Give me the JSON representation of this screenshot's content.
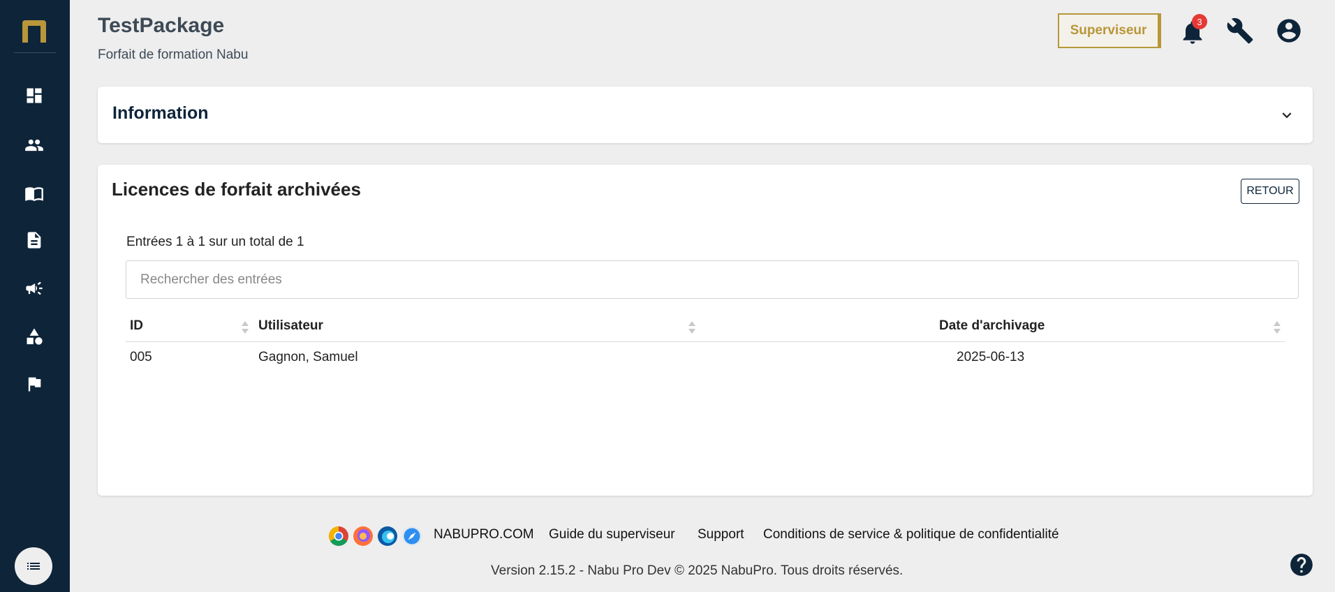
{
  "header": {
    "title": "TestPackage",
    "subtitle": "Forfait de formation Nabu",
    "role_button": "Superviseur",
    "notification_count": "3"
  },
  "sidebar": {
    "items": [
      {
        "icon": "dashboard-icon"
      },
      {
        "icon": "users-icon"
      },
      {
        "icon": "book-icon"
      },
      {
        "icon": "document-icon"
      },
      {
        "icon": "megaphone-icon"
      },
      {
        "icon": "shapes-icon"
      },
      {
        "icon": "flag-icon"
      }
    ],
    "toggle_icon": "list-icon"
  },
  "information": {
    "title": "Information"
  },
  "licences": {
    "title": "Licences de forfait archivées",
    "back_button": "RETOUR",
    "entries_text": "Entrées 1 à 1 sur un total de 1",
    "search_placeholder": "Rechercher des entrées",
    "columns": [
      "ID",
      "Utilisateur",
      "Date d'archivage"
    ],
    "rows": [
      {
        "id": "005",
        "user": "Gagnon, Samuel",
        "date": "2025-06-13"
      }
    ]
  },
  "footer": {
    "browser_icons": [
      "chrome-icon",
      "firefox-icon",
      "edge-icon",
      "safari-icon"
    ],
    "links": [
      "NABUPRO.COM",
      "Guide du superviseur",
      "Support",
      "Conditions de service & politique de confidentialité"
    ],
    "version": "Version 2.15.2 - Nabu Pro Dev © 2025 NabuPro. Tous droits réservés."
  },
  "colors": {
    "sidebar": "#0e2439",
    "accent_gold": "#b8963a",
    "badge": "#e53935"
  }
}
